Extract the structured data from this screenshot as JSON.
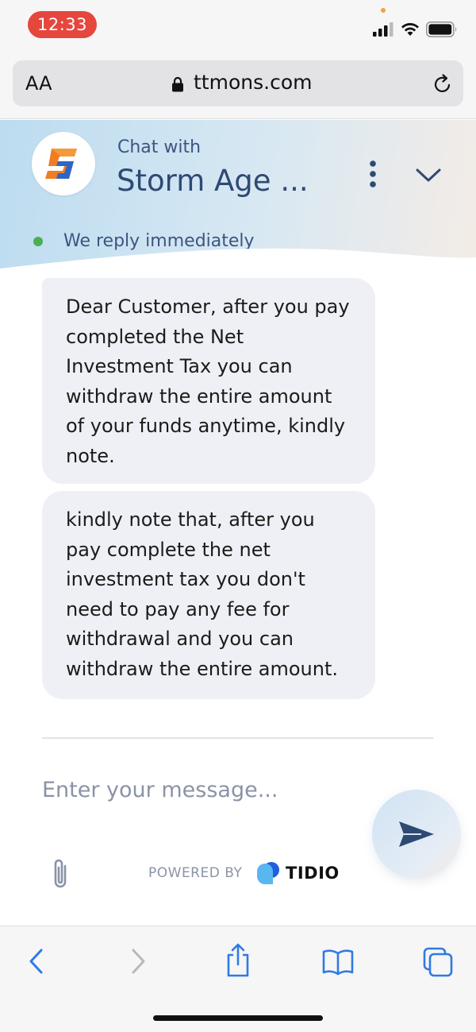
{
  "status_bar": {
    "time": "12:33",
    "icons": [
      "signal-icon",
      "wifi-icon",
      "battery-icon"
    ]
  },
  "browser": {
    "text_size_label": "AA",
    "url": "ttmons.com",
    "icons": [
      "lock-icon",
      "reload-icon"
    ]
  },
  "chat": {
    "header": {
      "subtitle": "Chat with",
      "name": "Storm Age ...",
      "status": "We reply immediately",
      "status_color": "#4caf50"
    },
    "messages": [
      {
        "text": "Dear Customer, after you pay completed the Net Investment Tax you can withdraw the entire amount of your funds anytime, kindly note."
      },
      {
        "text": "kindly note that, after you pay complete the net investment tax you don't need to pay any fee for withdrawal and you can withdraw the entire amount."
      }
    ],
    "input": {
      "placeholder": "Enter your message..."
    },
    "footer": {
      "powered_by": "POWERED BY",
      "brand": "TIDIO"
    }
  },
  "toolbar": {
    "items": [
      "back-icon",
      "forward-icon",
      "share-icon",
      "bookmarks-icon",
      "tabs-icon"
    ]
  },
  "colors": {
    "accent": "#2e4a73",
    "toolbar_blue": "#2f7ae5",
    "time_pill": "#e5473d"
  }
}
